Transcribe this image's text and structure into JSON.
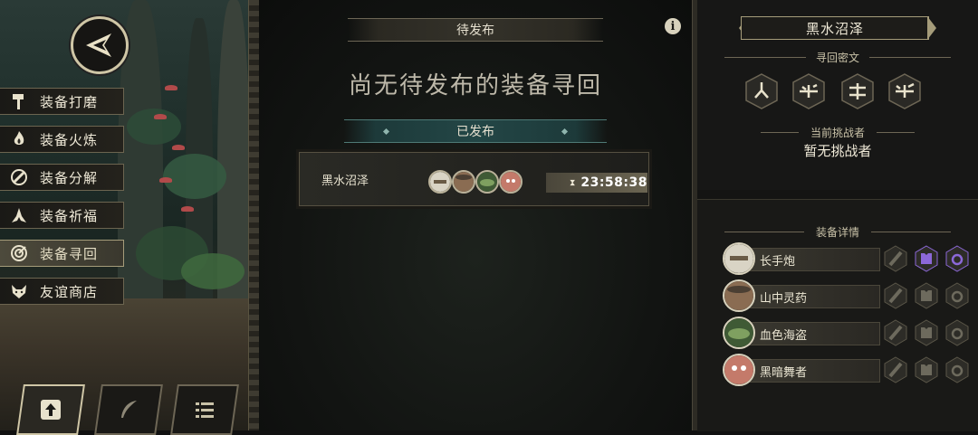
{
  "nav": {
    "back_label": "",
    "menu": [
      {
        "label": "装备打磨",
        "icon": "hammer-icon",
        "active": false
      },
      {
        "label": "装备火炼",
        "icon": "flame-icon",
        "active": false
      },
      {
        "label": "装备分解",
        "icon": "disassemble-icon",
        "active": false
      },
      {
        "label": "装备祈福",
        "icon": "pray-icon",
        "active": false
      },
      {
        "label": "装备寻回",
        "icon": "target-icon",
        "active": true
      },
      {
        "label": "友谊商店",
        "icon": "fox-icon",
        "active": false
      }
    ],
    "tools": [
      {
        "icon": "upload-icon",
        "active": true
      },
      {
        "icon": "feather-icon",
        "active": false
      },
      {
        "icon": "list-icon",
        "active": false
      }
    ]
  },
  "center": {
    "pending_header": "待发布",
    "pending_empty": "尚无待发布的装备寻回",
    "published_header": "已发布",
    "entry": {
      "name": "黑水沼泽",
      "timer": "23:58:38",
      "avatars": [
        "gunner-avatar",
        "herbalist-avatar",
        "pirate-avatar",
        "dancer-avatar"
      ]
    },
    "info_label": "i"
  },
  "right": {
    "location": "黑水沼泽",
    "code_header": "寻回密文",
    "glyphs": [
      "glyph-1",
      "glyph-2",
      "glyph-3",
      "glyph-4"
    ],
    "challenger_label": "当前挑战者",
    "challenger_value": "暂无挑战者",
    "equip_header": "装备详情",
    "equipment": [
      {
        "name": "长手炮",
        "avatar": "gunner-avatar",
        "slots": [
          "gun-slot",
          "armor-slot",
          "ring-slot"
        ],
        "filled": [
          false,
          true,
          true
        ]
      },
      {
        "name": "山中灵药",
        "avatar": "herbalist-avatar",
        "slots": [
          "gun-slot",
          "armor-slot",
          "ring-slot"
        ],
        "filled": [
          false,
          false,
          false
        ]
      },
      {
        "name": "血色海盗",
        "avatar": "pirate-avatar",
        "slots": [
          "gun-slot",
          "armor-slot",
          "ring-slot"
        ],
        "filled": [
          false,
          false,
          false
        ]
      },
      {
        "name": "黑暗舞者",
        "avatar": "dancer-avatar",
        "slots": [
          "gun-slot",
          "armor-slot",
          "ring-slot"
        ],
        "filled": [
          false,
          false,
          false
        ]
      }
    ]
  },
  "colors": {
    "accent": "#cfc6a6",
    "teal": "#234646",
    "equip_slot_active": "#8c68d8"
  }
}
